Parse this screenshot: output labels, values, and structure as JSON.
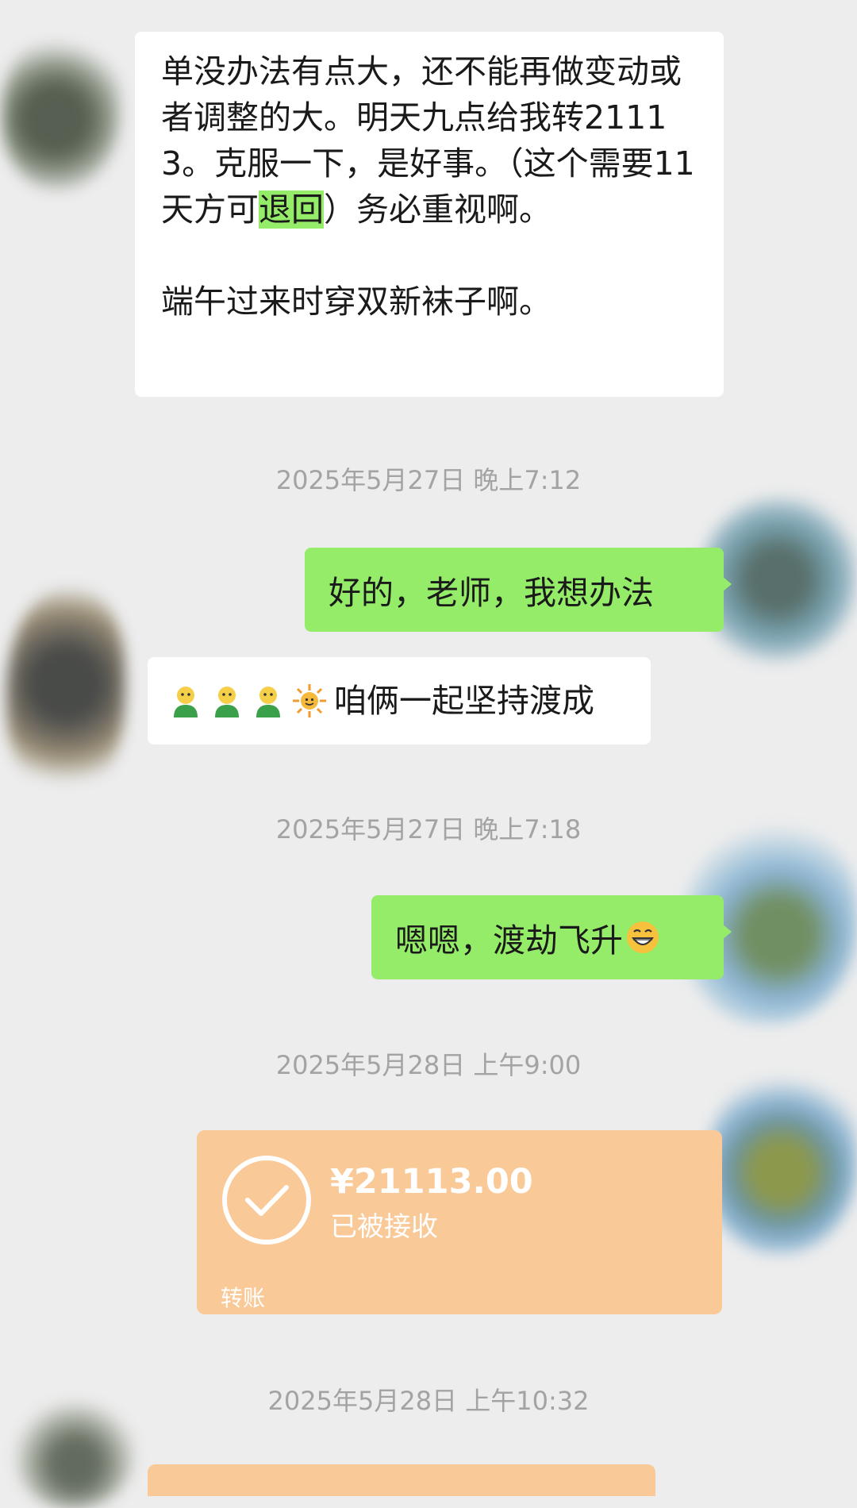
{
  "messages": {
    "m1_para1": "单没办法有点大，还不能再做变动或者调整的大。明天九点给我转21113。克服一下，是好事。（这个需要11天方可",
    "m1_highlight": "退回",
    "m1_para1_tail": "）务必重视啊。",
    "m1_para2": "端午过来时穿双新袜子啊。",
    "out1": "好的，老师，我想办法",
    "in2_text": "咱俩一起坚持渡成",
    "in2_emojis": [
      "person-emoji",
      "person-emoji",
      "person-emoji",
      "sun-emoji"
    ],
    "out2_text": "嗯嗯，渡劫飞升",
    "out2_emoji": "grin-emoji"
  },
  "timestamps": {
    "t1": "2025年5月27日 晚上7:12",
    "t2": "2025年5月27日 晚上7:18",
    "t3": "2025年5月28日 上午9:00",
    "t4": "2025年5月28日 上午10:32"
  },
  "transfer": {
    "amount": "¥21113.00",
    "status": "已被接收",
    "label": "转账",
    "icon": "check-circle-icon"
  },
  "colors": {
    "background": "#ededed",
    "outgoing": "#95ec69",
    "incoming": "#ffffff",
    "transfer": "#f9c998"
  }
}
